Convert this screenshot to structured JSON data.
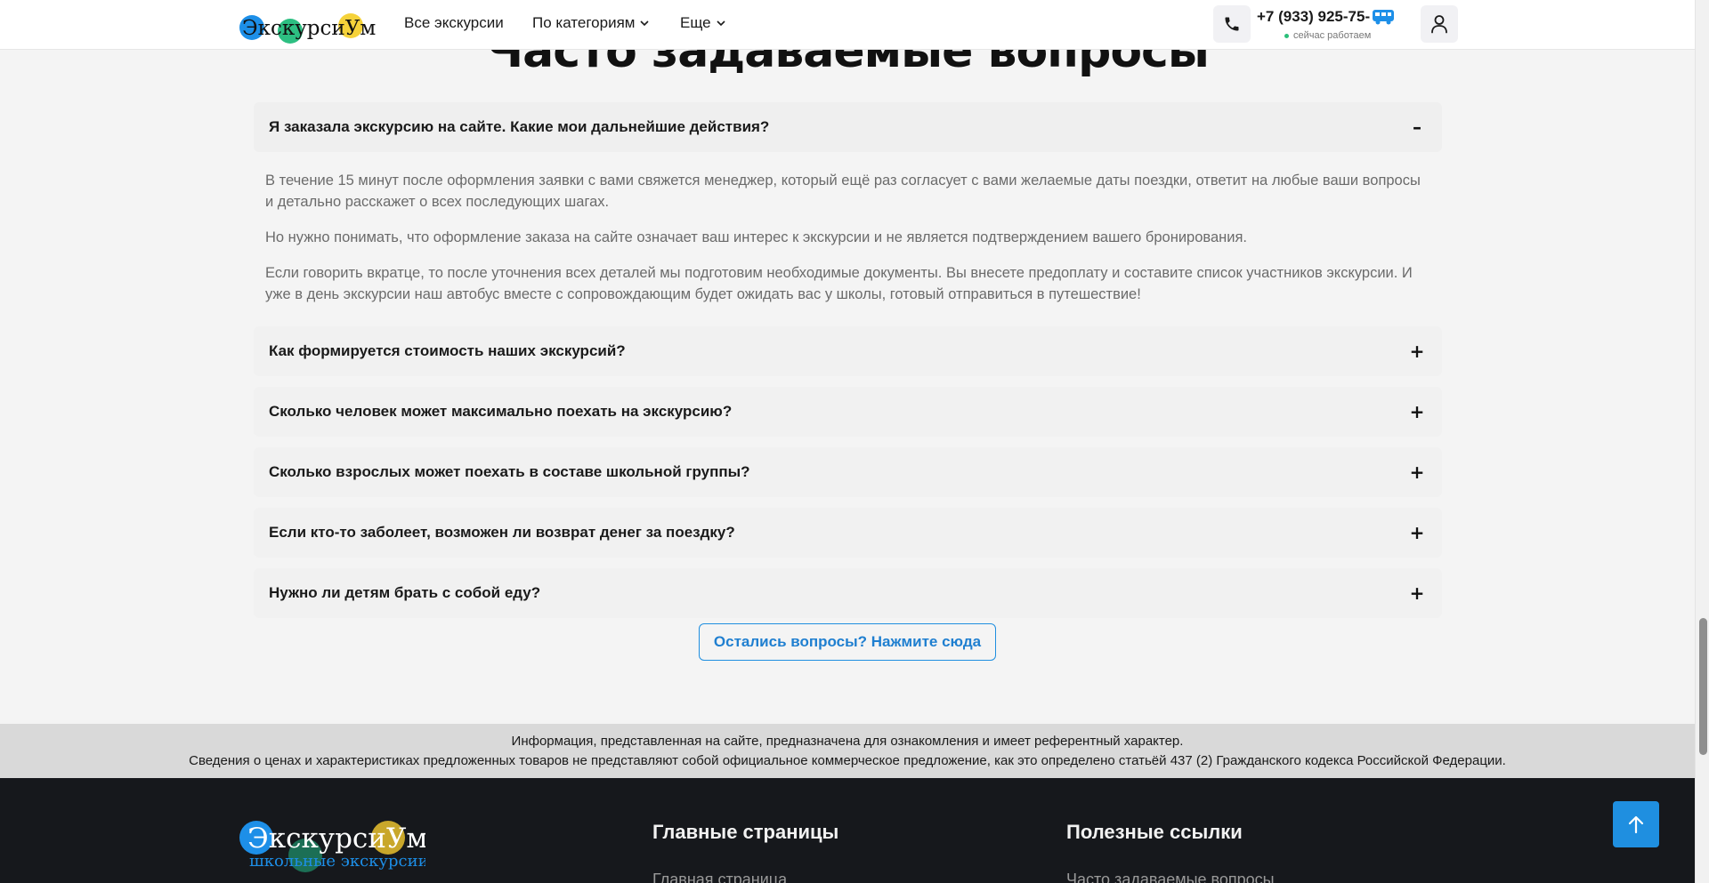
{
  "header": {
    "logo_text": "ЭкскурсиУм",
    "nav": [
      {
        "label": "Все экскурсии",
        "has_dropdown": false
      },
      {
        "label": "По категориям",
        "has_dropdown": true
      },
      {
        "label": "Еще",
        "has_dropdown": true
      }
    ],
    "phone": "+7 (933) 925-75-",
    "work_status": "сейчас работаем",
    "icons": [
      "phone-icon",
      "bus-icon",
      "user-icon"
    ]
  },
  "faq": {
    "title": "Часто задаваемые вопросы",
    "items": [
      {
        "question": "Я заказала экскурсию на сайте. Какие мои дальнейшие действия?",
        "open": true,
        "toggle": "–",
        "answer": [
          "В течение 15 минут после оформления заявки с вами свяжется менеджер, который ещё раз согласует с вами желаемые даты поездки, ответит на любые ваши вопросы и детально расскажет о всех последующих шагах.",
          "Но нужно понимать, что оформление заказа на сайте означает ваш интерес к экскурсии и не является подтверждением вашего бронирования.",
          "Если говорить вкратце, то после уточнения всех деталей мы подготовим необходимые документы. Вы внесете предоплату и составите список участников экскурсии. И уже в день экскурсии наш автобус вместе с сопровождающим будет ожидать вас у школы, готовый отправиться в путешествие!"
        ]
      },
      {
        "question": "Как формируется стоимость наших экскурсий?",
        "open": false,
        "toggle": "+"
      },
      {
        "question": "Сколько человек может максимально поехать на экскурсию?",
        "open": false,
        "toggle": "+"
      },
      {
        "question": "Сколько взрослых может поехать в составе школьной группы?",
        "open": false,
        "toggle": "+"
      },
      {
        "question": "Если кто-то заболеет, возможен ли возврат денег за поездку?",
        "open": false,
        "toggle": "+"
      },
      {
        "question": "Нужно ли детям брать с собой еду?",
        "open": false,
        "toggle": "+"
      }
    ],
    "more_button": "Остались вопросы? Нажмите сюда"
  },
  "disclaimer": {
    "line1": "Информация, представленная на сайте, предназначена для ознакомления и имеет референтный характер.",
    "line2": "Сведения о ценах и характеристиках предложенных товаров не представляют собой официальное коммерческое предложение, как это определено статьёй 437 (2) Гражданского кодекса Российской Федерации."
  },
  "footer": {
    "logo_text": "ЭкскурсиУм",
    "logo_subtitle": "школьные экскурсии",
    "col1_title": "Главные страницы",
    "col1_link": "Главная страница",
    "col2_title": "Полезные ссылки",
    "col2_link": "Часто задаваемые вопросы"
  },
  "colors": {
    "accent": "#1f8fe0",
    "logo_blue": "#1d8fe8",
    "logo_green": "#2dbf82",
    "logo_yellow": "#f5d23a",
    "footer_bg": "#16181c",
    "status_green": "#2bbf7a"
  }
}
